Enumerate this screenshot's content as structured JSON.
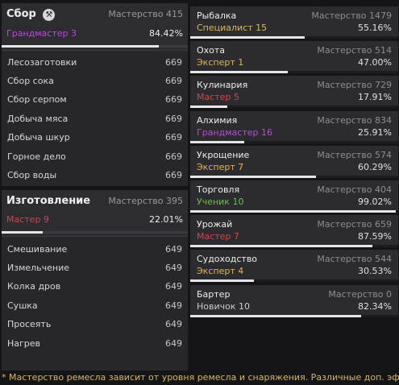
{
  "gathering": {
    "title": "Сбор",
    "mastery": "Мастерство 415",
    "rank": "Грандмастер 3",
    "rank_color": "#b84dd6",
    "percent": "84.42%",
    "progress": 0.8442,
    "skills": [
      {
        "name": "Лесозаготовки",
        "value": "669"
      },
      {
        "name": "Сбор сока",
        "value": "669"
      },
      {
        "name": "Сбор серпом",
        "value": "669"
      },
      {
        "name": "Добыча мяса",
        "value": "669"
      },
      {
        "name": "Добыча шкур",
        "value": "669"
      },
      {
        "name": "Горное дело",
        "value": "669"
      },
      {
        "name": "Сбор воды",
        "value": "669"
      }
    ]
  },
  "crafting": {
    "title": "Изготовление",
    "mastery": "Мастерство 395",
    "rank": "Мастер 9",
    "rank_color": "#d64545",
    "percent": "22.01%",
    "progress": 0.2201,
    "skills": [
      {
        "name": "Смешивание",
        "value": "649"
      },
      {
        "name": "Измельчение",
        "value": "649"
      },
      {
        "name": "Колка дров",
        "value": "649"
      },
      {
        "name": "Сушка",
        "value": "649"
      },
      {
        "name": "Просеять",
        "value": "649"
      },
      {
        "name": "Нагрев",
        "value": "649"
      }
    ]
  },
  "lifeskills": [
    {
      "name": "Рыбалка",
      "mastery": "Мастерство 1479",
      "rank": "Специалист 15",
      "rank_class": "gold",
      "percent": "55.16%",
      "progress": 0.5516
    },
    {
      "name": "Охота",
      "mastery": "Мастерство 514",
      "rank": "Эксперт 1",
      "rank_class": "gold",
      "percent": "47.00%",
      "progress": 0.47
    },
    {
      "name": "Кулинария",
      "mastery": "Мастерство 729",
      "rank": "Мастер 5",
      "rank_class": "red",
      "percent": "17.91%",
      "progress": 0.1791
    },
    {
      "name": "Алхимия",
      "mastery": "Мастерство 834",
      "rank": "Грандмастер 16",
      "rank_class": "purple",
      "percent": "25.91%",
      "progress": 0.2591
    },
    {
      "name": "Укрощение",
      "mastery": "Мастерство 574",
      "rank": "Эксперт 7",
      "rank_class": "gold",
      "percent": "60.29%",
      "progress": 0.6029
    },
    {
      "name": "Торговля",
      "mastery": "Мастерство 404",
      "rank": "Ученик 10",
      "rank_class": "green",
      "percent": "99.02%",
      "progress": 0.9902
    },
    {
      "name": "Урожай",
      "mastery": "Мастерство 659",
      "rank": "Мастер 7",
      "rank_class": "red",
      "percent": "87.59%",
      "progress": 0.8759
    },
    {
      "name": "Судоходство",
      "mastery": "Мастерство 544",
      "rank": "Эксперт 4",
      "rank_class": "gold",
      "percent": "30.53%",
      "progress": 0.3053
    },
    {
      "name": "Бартер",
      "mastery": "Мастерство 0",
      "rank": "Новичок 10",
      "rank_class": "gray",
      "percent": "82.34%",
      "progress": 0.8234
    }
  ],
  "icons": {
    "gathering_icon": "crossed-pickaxe-icon"
  },
  "footer": "* Мастерство ремесла зависит от уровня ремесла и снаряжения. Различные доп. эффекты"
}
